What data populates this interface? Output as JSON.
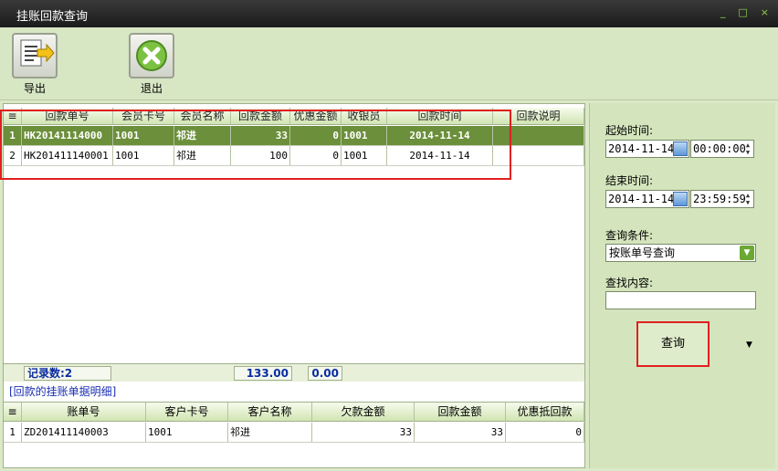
{
  "window": {
    "title": "挂账回款查询",
    "controls": [
      "_",
      "□",
      "×"
    ]
  },
  "toolbar": {
    "export_label": "导出",
    "exit_label": "退出"
  },
  "payments_table": {
    "columns": [
      "回款单号",
      "会员卡号",
      "会员名称",
      "回款金额",
      "优惠金额",
      "收银员",
      "回款时间",
      "回款说明"
    ],
    "rows": [
      {
        "idx": "1",
        "no": "HK20141114000",
        "card": "1001",
        "name": "祁进",
        "amount": "33",
        "discount": "0",
        "cashier": "1001",
        "time": "2014-11-14",
        "note": ""
      },
      {
        "idx": "2",
        "no": "HK201411140001",
        "card": "1001",
        "name": "祁进",
        "amount": "100",
        "discount": "0",
        "cashier": "1001",
        "time": "2014-11-14",
        "note": ""
      }
    ]
  },
  "summary": {
    "records_label": "记录数:2",
    "total_amount": "133.00",
    "total_discount": "0.00"
  },
  "detail": {
    "title": "[回款的挂账单据明细]",
    "columns": [
      "账单号",
      "客户卡号",
      "客户名称",
      "欠款金额",
      "回款金额",
      "优惠抵回款"
    ],
    "rows": [
      {
        "idx": "1",
        "bill": "ZD201411140003",
        "card": "1001",
        "name": "祁进",
        "debt": "33",
        "paid": "33",
        "offset": "0"
      }
    ]
  },
  "filters": {
    "start_label": "起始时间:",
    "start_date": "2014-11-14",
    "start_time": "00:00:00",
    "end_label": "结束时间:",
    "end_date": "2014-11-14",
    "end_time": "23:59:59",
    "condition_label": "查询条件:",
    "condition_value": "按账单号查询",
    "content_label": "查找内容:",
    "content_value": "",
    "query_label": "查询"
  }
}
